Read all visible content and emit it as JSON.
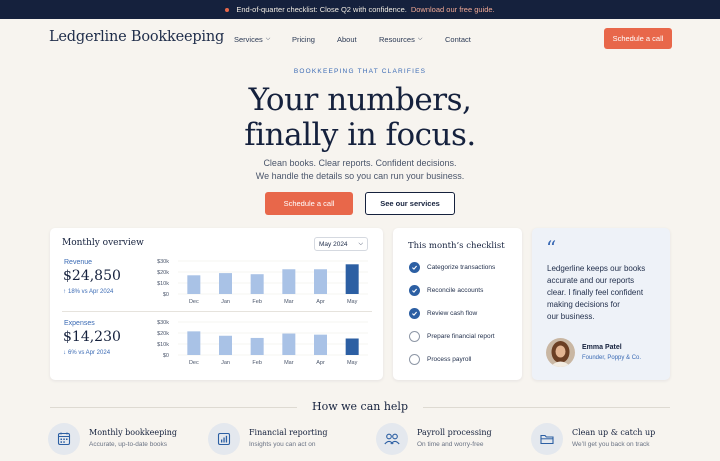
{
  "announcement": {
    "text": "End-of-quarter checklist: Close Q2 with confidence.",
    "link": "Download our free guide."
  },
  "nav": {
    "brand": "Ledgerline Bookkeeping",
    "items": [
      {
        "label": "Services",
        "dropdown": true
      },
      {
        "label": "Pricing",
        "dropdown": false
      },
      {
        "label": "About",
        "dropdown": false
      },
      {
        "label": "Resources",
        "dropdown": true
      },
      {
        "label": "Contact",
        "dropdown": false
      }
    ],
    "cta": "Schedule a call"
  },
  "hero": {
    "eyebrow": "BOOKKEEPING THAT CLARIFIES",
    "headline_line1": "Your numbers,",
    "headline_line2": "finally in focus.",
    "sub_line1": "Clean books. Clear reports. Confident decisions.",
    "sub_line2": "We handle the details so you can run your business.",
    "primary_cta": "Schedule a call",
    "secondary_cta": "See our services"
  },
  "overview": {
    "title": "Monthly overview",
    "period": "May 2024",
    "revenue": {
      "label": "Revenue",
      "value": "$24,850",
      "delta": "18% vs Apr 2024",
      "direction": "up"
    },
    "expenses": {
      "label": "Expenses",
      "value": "$14,230",
      "delta": "6% vs Apr 2024",
      "direction": "down"
    }
  },
  "chart_data": [
    {
      "type": "bar",
      "categories": [
        "Dec",
        "Jan",
        "Feb",
        "Mar",
        "Apr",
        "May"
      ],
      "values": [
        17000,
        19000,
        18000,
        22500,
        22500,
        27000
      ],
      "yticks": [
        "$0",
        "$10k",
        "$20k",
        "$30k"
      ],
      "ylim": [
        0,
        30000
      ],
      "highlight_index": 5
    },
    {
      "type": "bar",
      "categories": [
        "Dec",
        "Jan",
        "Feb",
        "Mar",
        "Apr",
        "May"
      ],
      "values": [
        21500,
        17500,
        15500,
        19500,
        18500,
        15000
      ],
      "yticks": [
        "$0",
        "$10k",
        "$20k",
        "$30k"
      ],
      "ylim": [
        0,
        30000
      ],
      "highlight_index": 5
    }
  ],
  "checklist": {
    "title": "This month’s checklist",
    "items": [
      {
        "label": "Categorize transactions",
        "done": true
      },
      {
        "label": "Reconcile accounts",
        "done": true
      },
      {
        "label": "Review cash flow",
        "done": true
      },
      {
        "label": "Prepare financial report",
        "done": false
      },
      {
        "label": "Process payroll",
        "done": false
      }
    ]
  },
  "testimonial": {
    "quote_line1": "Ledgerline keeps our books",
    "quote_line2": "accurate and our reports",
    "quote_line3": "clear. I finally feel confident",
    "quote_line4": "making decisions for",
    "quote_line5": "our business.",
    "name": "Emma Patel",
    "role": "Founder, Poppy & Co."
  },
  "services": {
    "title": "How we can help",
    "items": [
      {
        "name": "Monthly bookkeeping",
        "desc": "Accurate, up-to-date books",
        "icon": "calculator-icon"
      },
      {
        "name": "Financial reporting",
        "desc": "Insights you can act on",
        "icon": "bar-chart-icon"
      },
      {
        "name": "Payroll processing",
        "desc": "On time and worry-free",
        "icon": "people-icon"
      },
      {
        "name": "Clean up & catch up",
        "desc": "We’ll get you back on track",
        "icon": "folder-icon"
      }
    ]
  },
  "colors": {
    "navy": "#15213d",
    "accent": "#e8674a",
    "blue": "#3a6ab4",
    "bar_light": "#a9c2e6",
    "bar_dark": "#2c5fa3"
  }
}
